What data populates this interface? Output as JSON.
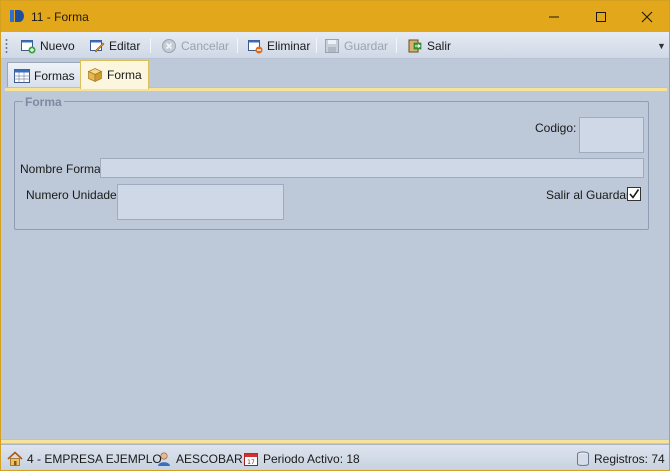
{
  "window": {
    "title": "11 - Forma"
  },
  "toolbar": {
    "buttons": [
      {
        "label": "Nuevo",
        "icon": "new-doc-icon",
        "enabled": true
      },
      {
        "label": "Editar",
        "icon": "edit-icon",
        "enabled": true
      },
      {
        "label": "Cancelar",
        "icon": "cancel-icon",
        "enabled": false
      },
      {
        "label": "Eliminar",
        "icon": "delete-icon",
        "enabled": true
      },
      {
        "label": "Guardar",
        "icon": "save-icon",
        "enabled": false
      },
      {
        "label": "Salir",
        "icon": "exit-icon",
        "enabled": true
      }
    ]
  },
  "tabs": [
    {
      "label": "Formas",
      "icon": "grid-icon",
      "active": false
    },
    {
      "label": "Forma",
      "icon": "box-icon",
      "active": true
    }
  ],
  "form": {
    "group_title": "Forma",
    "codigo_label": "Codigo:",
    "codigo_value": "",
    "nombre_label": "Nombre Forma:",
    "nombre_value": "",
    "unidades_label": "Numero Unidades",
    "unidades_value": "",
    "salir_label": "Salir al Guardar",
    "salir_checked": true
  },
  "status": {
    "empresa": "4 - EMPRESA EJEMPLO",
    "usuario": "AESCOBAR",
    "periodo": "Periodo Activo: 18",
    "registros": "Registros: 74"
  },
  "colors": {
    "titlebar": "#e2a71a",
    "accent_strip": "#f7e29a",
    "background": "#bdc8d8"
  }
}
